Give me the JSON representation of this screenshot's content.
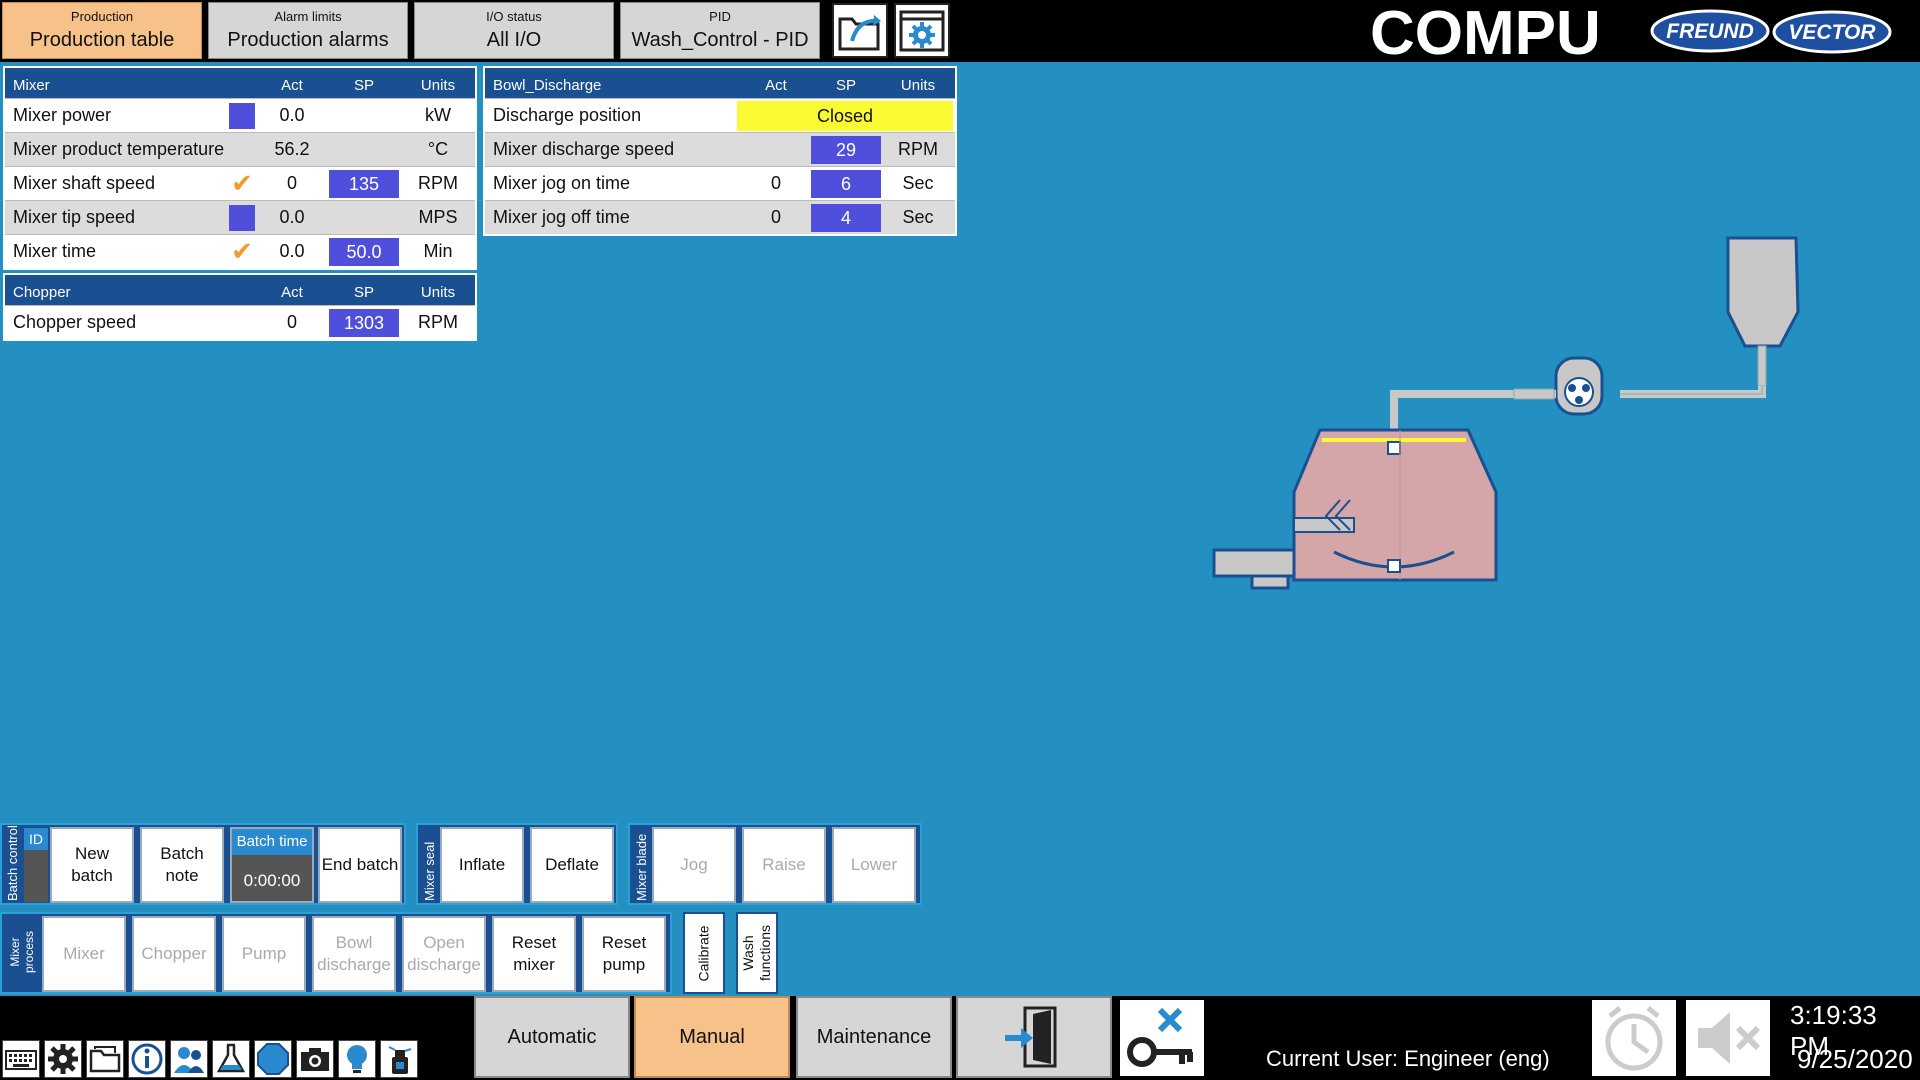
{
  "top_tabs": [
    {
      "caption": "Production",
      "label": "Production table",
      "active": true
    },
    {
      "caption": "Alarm limits",
      "label": "Production alarms",
      "active": false
    },
    {
      "caption": "I/O status",
      "label": "All I/O",
      "active": false
    },
    {
      "caption": "PID",
      "label": "Wash_Control - PID",
      "active": false
    }
  ],
  "brand": {
    "name": "COMPU",
    "badge1": "FREUND",
    "badge2": "VECTOR"
  },
  "mixer_table": {
    "title": "Mixer",
    "col_act": "Act",
    "col_sp": "SP",
    "col_units": "Units",
    "rows": [
      {
        "name": "Mixer power",
        "indicator": "blue-square",
        "act": "0.0",
        "sp": "",
        "units": "kW"
      },
      {
        "name": "Mixer product temperature",
        "indicator": "",
        "act": "56.2",
        "sp": "",
        "units": "°C"
      },
      {
        "name": "Mixer shaft speed",
        "indicator": "check",
        "act": "0",
        "sp": "135",
        "units": "RPM"
      },
      {
        "name": "Mixer tip speed",
        "indicator": "blue-square",
        "act": "0.0",
        "sp": "",
        "units": "MPS"
      },
      {
        "name": "Mixer time",
        "indicator": "check",
        "act": "0.0",
        "sp": "50.0",
        "units": "Min"
      }
    ]
  },
  "chopper_table": {
    "title": "Chopper",
    "col_act": "Act",
    "col_sp": "SP",
    "col_units": "Units",
    "rows": [
      {
        "name": "Chopper speed",
        "act": "0",
        "sp": "1303",
        "units": "RPM"
      }
    ]
  },
  "bowl_table": {
    "title": "Bowl_Discharge",
    "col_act": "Act",
    "col_sp": "SP",
    "col_units": "Units",
    "discharge_position": {
      "name": "Discharge position",
      "value": "Closed"
    },
    "rows": [
      {
        "name": "Mixer discharge speed",
        "act": "",
        "sp": "29",
        "units": "RPM"
      },
      {
        "name": "Mixer jog on time",
        "act": "0",
        "sp": "6",
        "units": "Sec"
      },
      {
        "name": "Mixer jog off time",
        "act": "0",
        "sp": "4",
        "units": "Sec"
      }
    ]
  },
  "batch_control": {
    "group_label": "Batch control",
    "id_label": "ID",
    "new_batch": "New batch",
    "batch_note": "Batch note",
    "batch_time_label": "Batch time",
    "batch_time_value": "0:00:00",
    "end_batch": "End batch"
  },
  "mixer_seal": {
    "group_label": "Mixer seal",
    "inflate": "Inflate",
    "deflate": "Deflate"
  },
  "mixer_blade": {
    "group_label": "Mixer blade",
    "jog": "Jog",
    "raise": "Raise",
    "lower": "Lower"
  },
  "mixer_process": {
    "group_label": "Mixer process",
    "mixer": "Mixer",
    "chopper": "Chopper",
    "pump": "Pump",
    "bowl_discharge": "Bowl discharge",
    "open_discharge": "Open discharge",
    "reset_mixer": "Reset mixer",
    "reset_pump": "Reset pump",
    "calibrate": "Calibrate",
    "wash_functions": "Wash functions"
  },
  "footer": {
    "modes": [
      {
        "label": "Automatic",
        "active": false
      },
      {
        "label": "Manual",
        "active": true
      },
      {
        "label": "Maintenance",
        "active": false
      }
    ],
    "current_user": "Current User: Engineer (eng)",
    "time": "3:19:33 PM",
    "date": "9/25/2020"
  },
  "colors": {
    "accent": "#f7c289",
    "sp_blue": "#4f4fdc",
    "background": "#2390c1",
    "header_blue": "#1a4f91",
    "closed_yellow": "#fafa32"
  }
}
